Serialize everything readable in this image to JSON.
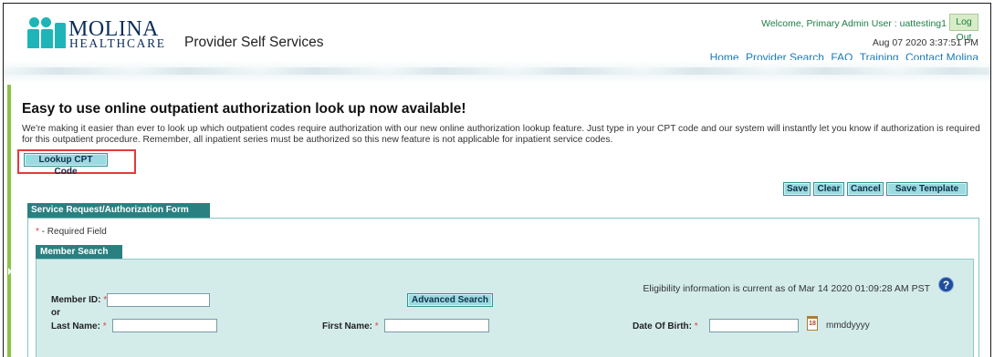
{
  "header": {
    "brand_line1": "MOLINA",
    "brand_line2": "HEALTHCARE",
    "app_title": "Provider Self Services",
    "welcome": "Welcome, Primary Admin User : uattesting1",
    "logout_label": "Log Out",
    "datetime": "Aug 07 2020 3:37:51 PM",
    "nav": [
      "Home",
      "Provider Search",
      "FAQ",
      "Training",
      "Contact Molina"
    ]
  },
  "announcement": {
    "headline": "Easy to use online outpatient authorization look up now available!",
    "description": "We're making it easier than ever to look up which outpatient codes require authorization with our new online authorization lookup feature. Just type in your CPT code and our system will instantly let you know if authorization is required for this outpatient procedure. Remember, all inpatient series must be authorized so this new feature is not applicable for inpatient service codes.",
    "lookup_button": "Lookup CPT Code"
  },
  "toolbar": {
    "save": "Save",
    "clear": "Clear",
    "cancel": "Cancel",
    "save_template": "Save Template"
  },
  "form": {
    "tab_title": "Service Request/Authorization Form",
    "required_star": "*",
    "required_note": " - Required Field",
    "member_search": {
      "tab_title": "Member Search",
      "eligibility_note": "Eligibility information is current as of Mar 14 2020 01:09:28 AM PST",
      "help_symbol": "?",
      "member_id_label": "Member ID:",
      "member_id_value": "",
      "or_text": "or",
      "last_name_label": "Last Name:",
      "last_name_value": "",
      "first_name_label": "First Name:",
      "first_name_value": "",
      "dob_label": "Date Of Birth:",
      "dob_value": "",
      "dob_hint": "mmddyyyy",
      "calendar_day": "18",
      "advanced_search": "Advanced Search"
    }
  },
  "colors": {
    "accent_teal": "#2a8080",
    "button_fill": "#9adbe0",
    "link_blue": "#1a7bb8",
    "welcome_green": "#1c7f46",
    "highlight_red": "#e33b3b",
    "panel_bg": "#d3ecea",
    "sidebar_green": "#8bc34a"
  },
  "icons": {
    "help": "question-circle-icon",
    "calendar": "calendar-icon",
    "logo": "molina-people-logo"
  }
}
